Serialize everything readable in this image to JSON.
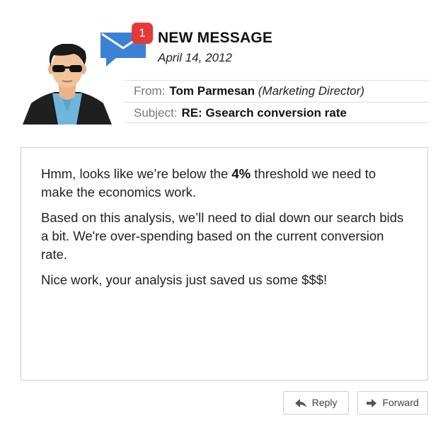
{
  "message": {
    "badge_count": "1",
    "title": "NEW MESSAGE",
    "date": "April 14, 2012",
    "from_label": "From:",
    "from_name": "Tom Parmesan",
    "from_role": "(Marketing Director)",
    "subject_label": "Subject:",
    "subject": "RE: Gsearch conversion rate"
  },
  "body": {
    "p1_a": "Hmm, looks like we’re below the ",
    "p1_bold": "4%",
    "p1_b": " threshold we need to make the economics work.",
    "p2": "Based on this analysis, we’ll need to dial down our search bids a bit. We're over-spending based on the current conversion rate.",
    "p3": "Nice work, your analysis just saved us some $$$!"
  },
  "actions": {
    "reply_label": "Reply",
    "forward_label": "Forward"
  },
  "colors": {
    "mail_icon": "#3b82d6",
    "badge": "#e53935"
  },
  "icons": {
    "mail": "envelope-icon",
    "reply": "reply-arrow-icon",
    "forward": "forward-arrow-icon",
    "avatar": "man-with-sunglasses-avatar"
  }
}
